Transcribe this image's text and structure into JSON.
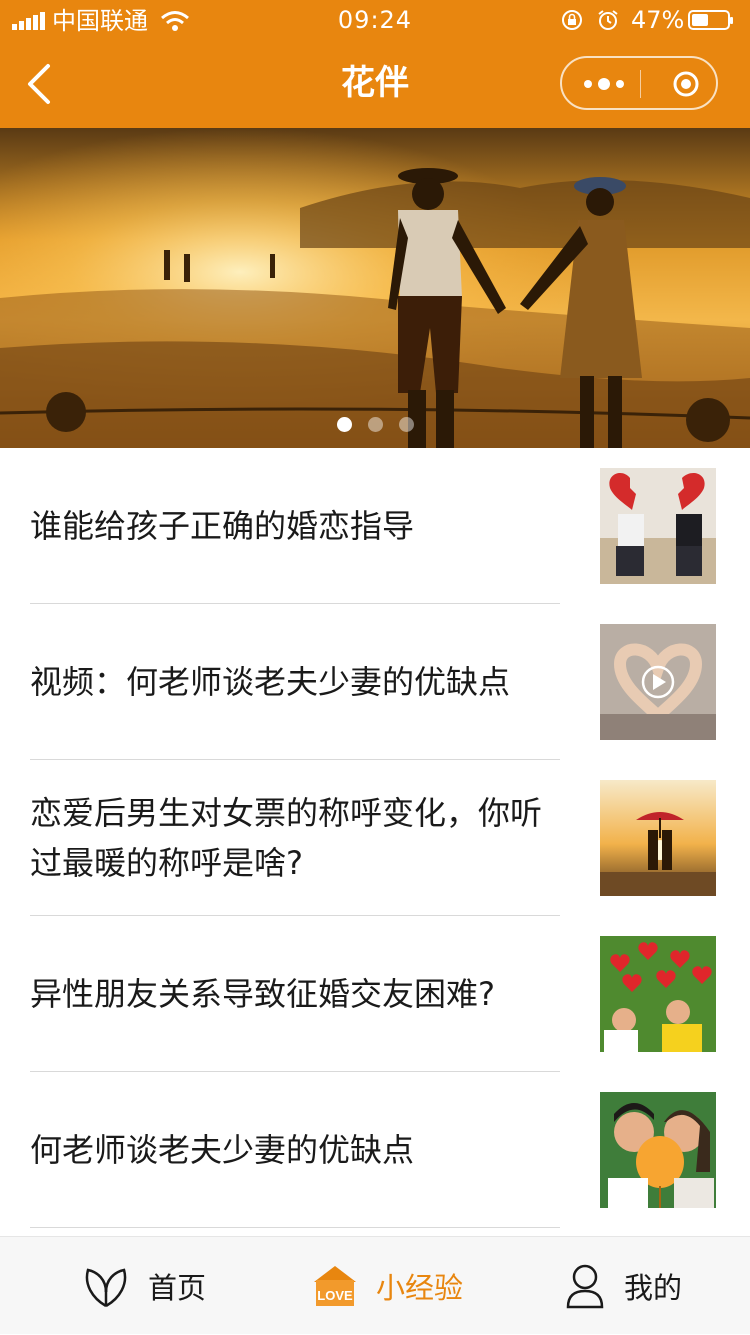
{
  "status_bar": {
    "carrier": "中国联通",
    "time": "09:24",
    "battery_percent": "47%",
    "battery_level": 0.47
  },
  "nav": {
    "title": "花伴"
  },
  "banner": {
    "slide_count": 3,
    "active_slide": 0
  },
  "articles": [
    {
      "title": "谁能给孩子正确的婚恋指导",
      "thumb": "broken-heart-couple",
      "is_video": false
    },
    {
      "title": "视频：何老师谈老夫少妻的优缺点",
      "thumb": "heart-hands-video",
      "is_video": true
    },
    {
      "title": "恋爱后男生对女票的称呼变化，你听过最暖的称呼是啥?",
      "thumb": "sunset-umbrella-couple",
      "is_video": false
    },
    {
      "title": "异性朋友关系导致征婚交友困难?",
      "thumb": "hearts-grass-couple",
      "is_video": false
    },
    {
      "title": "何老师谈老夫少妻的优缺点",
      "thumb": "balloon-kiss-couple",
      "is_video": false
    }
  ],
  "tabbar": {
    "tabs": [
      {
        "label": "首页",
        "icon": "leaf-icon",
        "active": false
      },
      {
        "label": "小经验",
        "icon": "love-house-icon",
        "badge_text": "LOVE",
        "active": true
      },
      {
        "label": "我的",
        "icon": "user-icon",
        "active": false
      }
    ]
  },
  "colors": {
    "brand": "#e8860f",
    "text": "#1a1a1a",
    "divider": "#d9d9d9"
  }
}
